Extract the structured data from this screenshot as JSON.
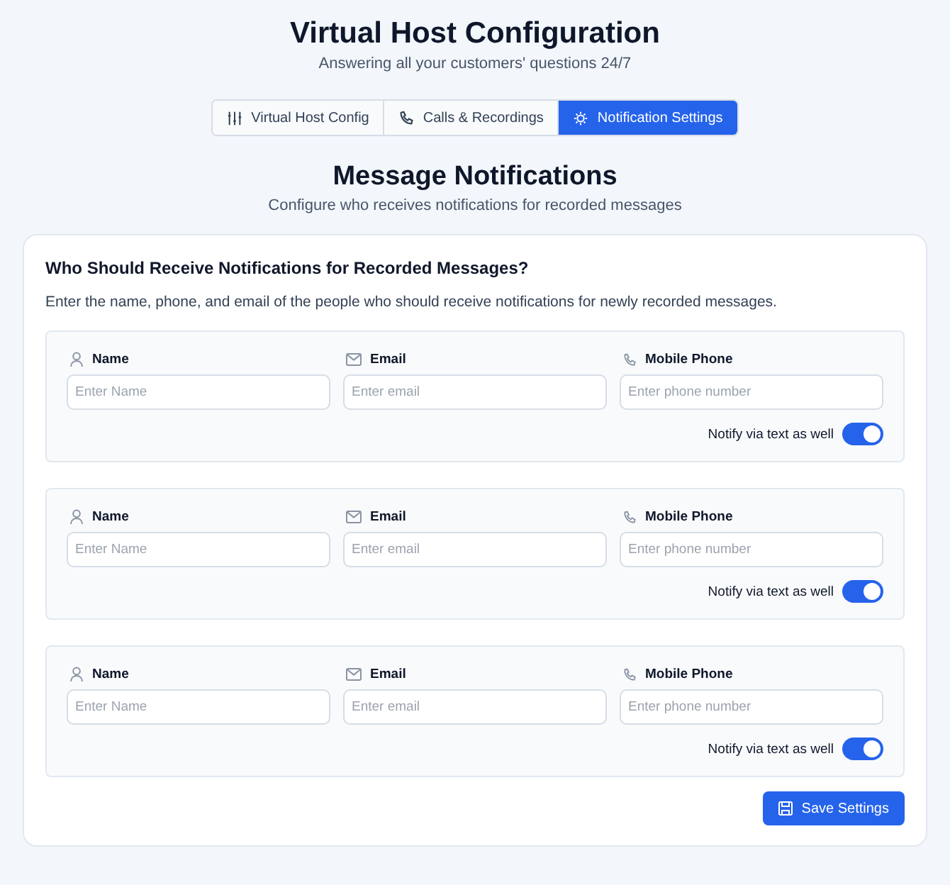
{
  "header": {
    "title": "Virtual Host Configuration",
    "subtitle": "Answering all your customers' questions 24/7"
  },
  "tabs": [
    {
      "label": "Virtual Host Config",
      "selected": false
    },
    {
      "label": "Calls & Recordings",
      "selected": false
    },
    {
      "label": "Notification Settings",
      "selected": true
    }
  ],
  "section": {
    "title": "Message Notifications",
    "subtitle": "Configure who receives notifications for recorded messages"
  },
  "card": {
    "title": "Who Should Receive Notifications for Recorded Messages?",
    "description": "Enter the name, phone, and email of the people who should receive notifications for newly recorded messages.",
    "recipients": [
      {
        "fields": [
          {
            "label": "Name",
            "placeholder": "Enter Name"
          },
          {
            "label": "Email",
            "placeholder": "Enter email"
          },
          {
            "label": "Mobile Phone",
            "placeholder": "Enter phone number"
          }
        ],
        "notify_label": "Notify via text as well",
        "notify_on": true
      },
      {
        "fields": [
          {
            "label": "Name",
            "placeholder": "Enter Name"
          },
          {
            "label": "Email",
            "placeholder": "Enter email"
          },
          {
            "label": "Mobile Phone",
            "placeholder": "Enter phone number"
          }
        ],
        "notify_label": "Notify via text as well",
        "notify_on": true
      },
      {
        "fields": [
          {
            "label": "Name",
            "placeholder": "Enter Name"
          },
          {
            "label": "Email",
            "placeholder": "Enter email"
          },
          {
            "label": "Mobile Phone",
            "placeholder": "Enter phone number"
          }
        ],
        "notify_label": "Notify via text as well",
        "notify_on": true
      }
    ],
    "save_button": "Save Settings"
  }
}
